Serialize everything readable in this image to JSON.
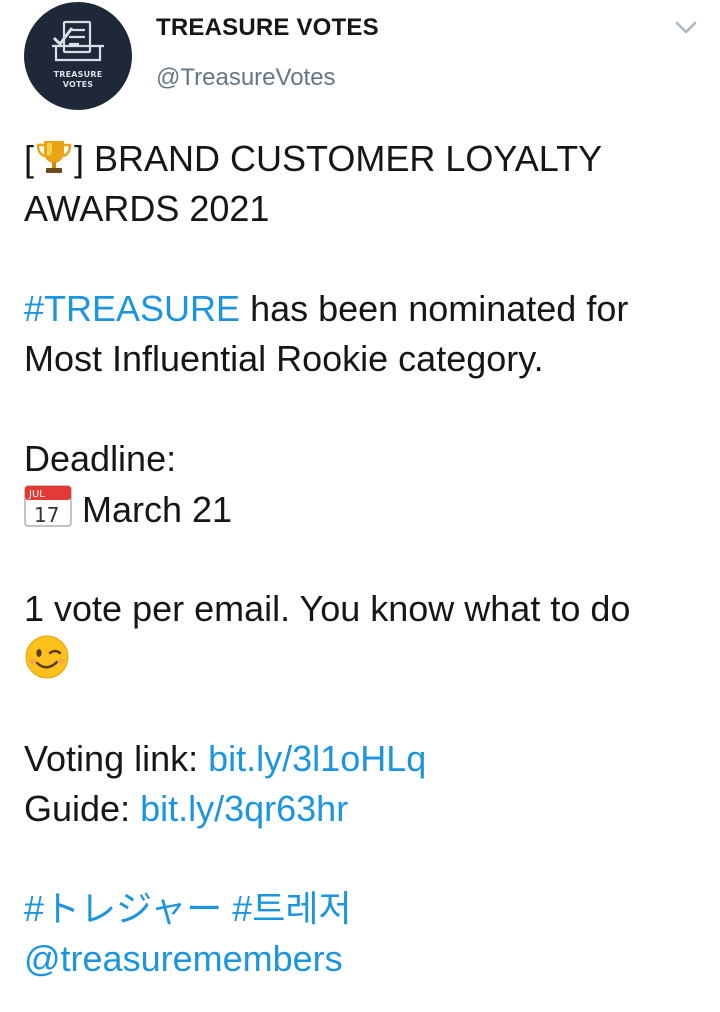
{
  "account": {
    "display_name": "TREASURE VOTES",
    "handle": "@TreasureVotes",
    "avatar_text_line1": "TREASURE",
    "avatar_text_line2": "VOTES"
  },
  "icons": {
    "avatar_icon": "ballot-box-icon",
    "menu": "chevron-down-icon",
    "trophy": "trophy-icon",
    "calendar": "calendar-icon",
    "wink": "winking-face-icon"
  },
  "calendar_emoji": {
    "month": "JUL",
    "day": "17"
  },
  "tweet": {
    "title_bracket_open": "[",
    "title_line1": "] BRAND CUSTOMER LOYALTY",
    "title_line2": "AWARDS 2021",
    "hashtag_treasure": "#TREASURE",
    "nomination_line1_rest": " has been nominated for",
    "nomination_line2": "Most Influential Rookie category.",
    "deadline_label": "Deadline:",
    "deadline_date": " March 21",
    "vote_line": "1 vote per email. You know what to do",
    "voting_label": "Voting link: ",
    "voting_link": "bit.ly/3l1oHLq",
    "guide_label": "Guide: ",
    "guide_link": "bit.ly/3qr63hr",
    "hashtag_japanese": "#トレジャー",
    "hashtag_korean": "#트레저",
    "mention": "@treasuremembers"
  },
  "colors": {
    "link": "#1b95e0",
    "text": "#14171a",
    "secondary": "#657786",
    "avatar_bg": "#1e2838"
  }
}
